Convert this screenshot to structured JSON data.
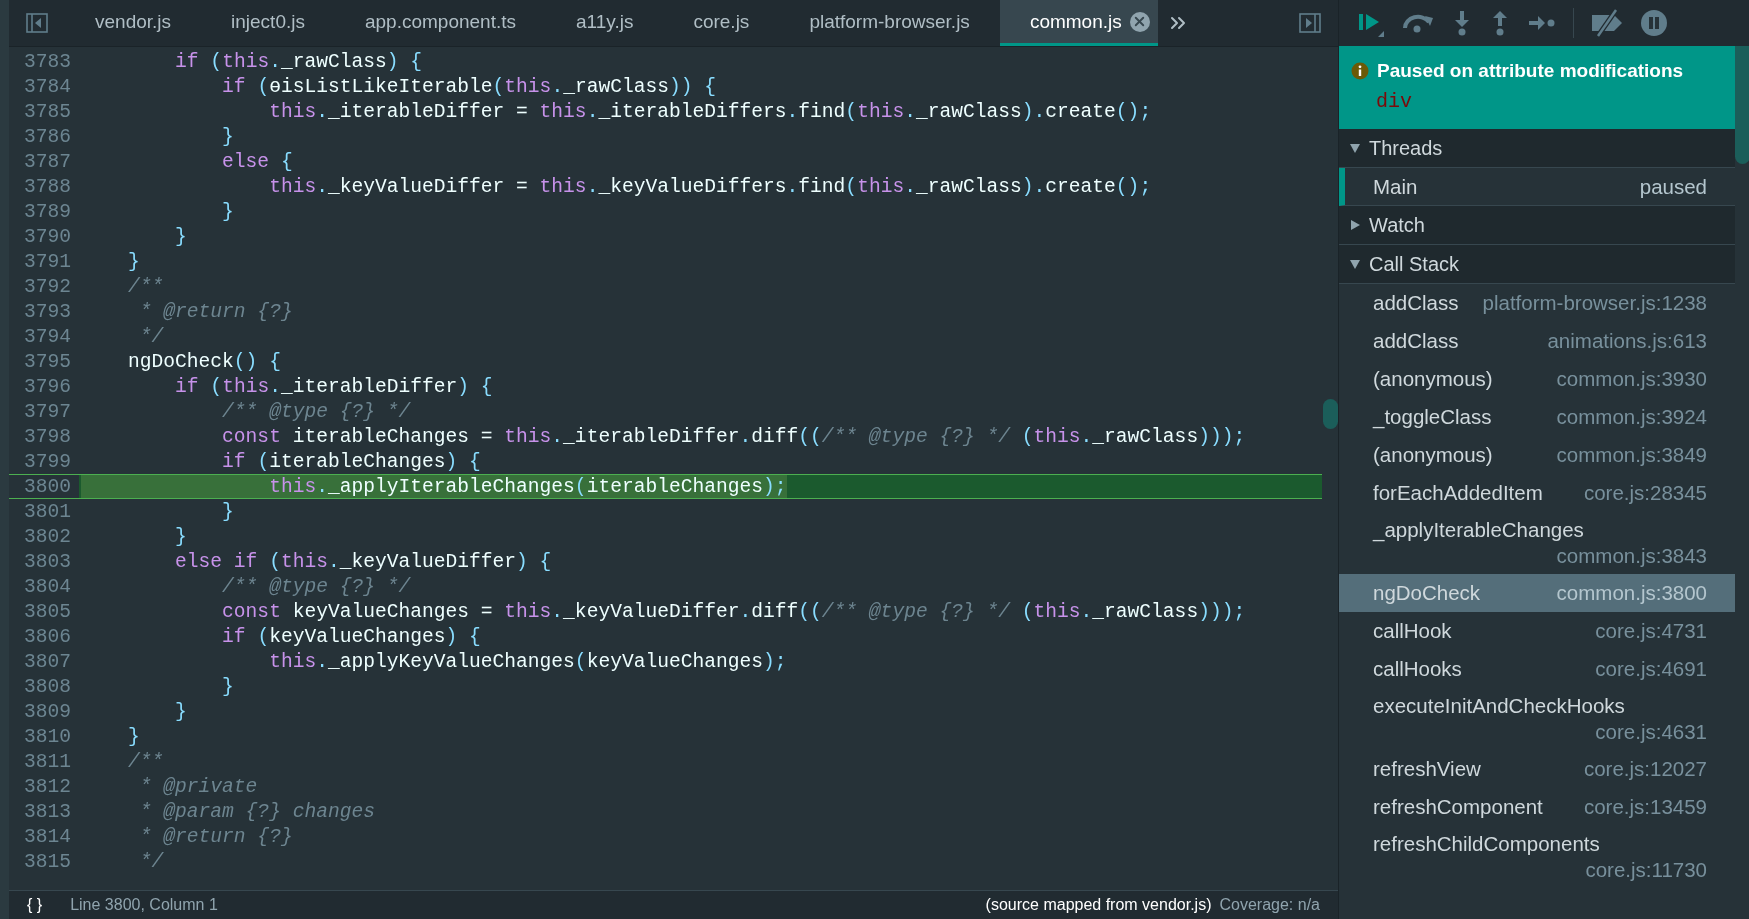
{
  "tabs": [
    {
      "label": "vendor.js",
      "selected": false
    },
    {
      "label": "inject0.js",
      "selected": false
    },
    {
      "label": "app.component.ts",
      "selected": false
    },
    {
      "label": "a11y.js",
      "selected": false
    },
    {
      "label": "core.js",
      "selected": false
    },
    {
      "label": "platform-browser.js",
      "selected": false
    },
    {
      "label": "common.js",
      "selected": true
    }
  ],
  "code_lines": [
    {
      "number": "3783",
      "current": false,
      "tokens": [
        {
          "kind": "keyword",
          "text": "        if"
        },
        {
          "kind": "punct",
          "text": " ("
        },
        {
          "kind": "keyword",
          "text": "this"
        },
        {
          "kind": "punct",
          "text": "."
        },
        {
          "kind": "ident",
          "text": "_rawClass"
        },
        {
          "kind": "punct",
          "text": ") {"
        }
      ]
    },
    {
      "number": "3784",
      "current": false,
      "tokens": [
        {
          "kind": "keyword",
          "text": "            if"
        },
        {
          "kind": "punct",
          "text": " ("
        },
        {
          "kind": "ident",
          "text": "ɵisListLikeIterable"
        },
        {
          "kind": "punct",
          "text": "("
        },
        {
          "kind": "keyword",
          "text": "this"
        },
        {
          "kind": "punct",
          "text": "."
        },
        {
          "kind": "ident",
          "text": "_rawClass"
        },
        {
          "kind": "punct",
          "text": ")) {"
        }
      ]
    },
    {
      "number": "3785",
      "current": false,
      "tokens": [
        {
          "kind": "keyword",
          "text": "                this"
        },
        {
          "kind": "punct",
          "text": "."
        },
        {
          "kind": "ident",
          "text": "_iterableDiffer = "
        },
        {
          "kind": "keyword",
          "text": "this"
        },
        {
          "kind": "punct",
          "text": "."
        },
        {
          "kind": "ident",
          "text": "_iterableDiffers"
        },
        {
          "kind": "punct",
          "text": "."
        },
        {
          "kind": "ident",
          "text": "find"
        },
        {
          "kind": "punct",
          "text": "("
        },
        {
          "kind": "keyword",
          "text": "this"
        },
        {
          "kind": "punct",
          "text": "."
        },
        {
          "kind": "ident",
          "text": "_rawClass"
        },
        {
          "kind": "punct",
          "text": ")."
        },
        {
          "kind": "ident",
          "text": "create"
        },
        {
          "kind": "punct",
          "text": "();"
        }
      ]
    },
    {
      "number": "3786",
      "current": false,
      "tokens": [
        {
          "kind": "punct",
          "text": "            }"
        }
      ]
    },
    {
      "number": "3787",
      "current": false,
      "tokens": [
        {
          "kind": "keyword",
          "text": "            else"
        },
        {
          "kind": "punct",
          "text": " {"
        }
      ]
    },
    {
      "number": "3788",
      "current": false,
      "tokens": [
        {
          "kind": "keyword",
          "text": "                this"
        },
        {
          "kind": "punct",
          "text": "."
        },
        {
          "kind": "ident",
          "text": "_keyValueDiffer = "
        },
        {
          "kind": "keyword",
          "text": "this"
        },
        {
          "kind": "punct",
          "text": "."
        },
        {
          "kind": "ident",
          "text": "_keyValueDiffers"
        },
        {
          "kind": "punct",
          "text": "."
        },
        {
          "kind": "ident",
          "text": "find"
        },
        {
          "kind": "punct",
          "text": "("
        },
        {
          "kind": "keyword",
          "text": "this"
        },
        {
          "kind": "punct",
          "text": "."
        },
        {
          "kind": "ident",
          "text": "_rawClass"
        },
        {
          "kind": "punct",
          "text": ")."
        },
        {
          "kind": "ident",
          "text": "create"
        },
        {
          "kind": "punct",
          "text": "();"
        }
      ]
    },
    {
      "number": "3789",
      "current": false,
      "tokens": [
        {
          "kind": "punct",
          "text": "            }"
        }
      ]
    },
    {
      "number": "3790",
      "current": false,
      "tokens": [
        {
          "kind": "punct",
          "text": "        }"
        }
      ]
    },
    {
      "number": "3791",
      "current": false,
      "tokens": [
        {
          "kind": "punct",
          "text": "    }"
        }
      ]
    },
    {
      "number": "3792",
      "current": false,
      "tokens": [
        {
          "kind": "comment",
          "text": "    /**"
        }
      ]
    },
    {
      "number": "3793",
      "current": false,
      "tokens": [
        {
          "kind": "comment",
          "text": "     * @return {?}"
        }
      ]
    },
    {
      "number": "3794",
      "current": false,
      "tokens": [
        {
          "kind": "comment",
          "text": "     */"
        }
      ]
    },
    {
      "number": "3795",
      "current": false,
      "tokens": [
        {
          "kind": "ident",
          "text": "    ngDoCheck"
        },
        {
          "kind": "punct",
          "text": "() {"
        }
      ]
    },
    {
      "number": "3796",
      "current": false,
      "tokens": [
        {
          "kind": "keyword",
          "text": "        if"
        },
        {
          "kind": "punct",
          "text": " ("
        },
        {
          "kind": "keyword",
          "text": "this"
        },
        {
          "kind": "punct",
          "text": "."
        },
        {
          "kind": "ident",
          "text": "_iterableDiffer"
        },
        {
          "kind": "punct",
          "text": ") {"
        }
      ]
    },
    {
      "number": "3797",
      "current": false,
      "tokens": [
        {
          "kind": "comment",
          "text": "            /** @type {?} */"
        }
      ]
    },
    {
      "number": "3798",
      "current": false,
      "tokens": [
        {
          "kind": "keyword",
          "text": "            const"
        },
        {
          "kind": "ident",
          "text": " iterableChanges = "
        },
        {
          "kind": "keyword",
          "text": "this"
        },
        {
          "kind": "punct",
          "text": "."
        },
        {
          "kind": "ident",
          "text": "_iterableDiffer"
        },
        {
          "kind": "punct",
          "text": "."
        },
        {
          "kind": "ident",
          "text": "diff"
        },
        {
          "kind": "punct",
          "text": "(("
        },
        {
          "kind": "comment",
          "text": "/** @type {?} */"
        },
        {
          "kind": "punct",
          "text": " ("
        },
        {
          "kind": "keyword",
          "text": "this"
        },
        {
          "kind": "punct",
          "text": "."
        },
        {
          "kind": "ident",
          "text": "_rawClass"
        },
        {
          "kind": "punct",
          "text": ")));"
        }
      ]
    },
    {
      "number": "3799",
      "current": false,
      "tokens": [
        {
          "kind": "keyword",
          "text": "            if"
        },
        {
          "kind": "punct",
          "text": " ("
        },
        {
          "kind": "ident",
          "text": "iterableChanges"
        },
        {
          "kind": "punct",
          "text": ") {"
        }
      ]
    },
    {
      "number": "3800",
      "current": true,
      "tokens": [
        {
          "kind": "keyword",
          "text": "                this"
        },
        {
          "kind": "punct",
          "text": "."
        },
        {
          "kind": "ident",
          "text": "_applyIterableChanges"
        },
        {
          "kind": "punct",
          "text": "("
        },
        {
          "kind": "ident",
          "text": "iterableChanges"
        },
        {
          "kind": "punct",
          "text": ");"
        }
      ]
    },
    {
      "number": "3801",
      "current": false,
      "tokens": [
        {
          "kind": "punct",
          "text": "            }"
        }
      ]
    },
    {
      "number": "3802",
      "current": false,
      "tokens": [
        {
          "kind": "punct",
          "text": "        }"
        }
      ]
    },
    {
      "number": "3803",
      "current": false,
      "tokens": [
        {
          "kind": "keyword",
          "text": "        else if"
        },
        {
          "kind": "punct",
          "text": " ("
        },
        {
          "kind": "keyword",
          "text": "this"
        },
        {
          "kind": "punct",
          "text": "."
        },
        {
          "kind": "ident",
          "text": "_keyValueDiffer"
        },
        {
          "kind": "punct",
          "text": ") {"
        }
      ]
    },
    {
      "number": "3804",
      "current": false,
      "tokens": [
        {
          "kind": "comment",
          "text": "            /** @type {?} */"
        }
      ]
    },
    {
      "number": "3805",
      "current": false,
      "tokens": [
        {
          "kind": "keyword",
          "text": "            const"
        },
        {
          "kind": "ident",
          "text": " keyValueChanges = "
        },
        {
          "kind": "keyword",
          "text": "this"
        },
        {
          "kind": "punct",
          "text": "."
        },
        {
          "kind": "ident",
          "text": "_keyValueDiffer"
        },
        {
          "kind": "punct",
          "text": "."
        },
        {
          "kind": "ident",
          "text": "diff"
        },
        {
          "kind": "punct",
          "text": "(("
        },
        {
          "kind": "comment",
          "text": "/** @type {?} */"
        },
        {
          "kind": "punct",
          "text": " ("
        },
        {
          "kind": "keyword",
          "text": "this"
        },
        {
          "kind": "punct",
          "text": "."
        },
        {
          "kind": "ident",
          "text": "_rawClass"
        },
        {
          "kind": "punct",
          "text": ")));"
        }
      ]
    },
    {
      "number": "3806",
      "current": false,
      "tokens": [
        {
          "kind": "keyword",
          "text": "            if"
        },
        {
          "kind": "punct",
          "text": " ("
        },
        {
          "kind": "ident",
          "text": "keyValueChanges"
        },
        {
          "kind": "punct",
          "text": ") {"
        }
      ]
    },
    {
      "number": "3807",
      "current": false,
      "tokens": [
        {
          "kind": "keyword",
          "text": "                this"
        },
        {
          "kind": "punct",
          "text": "."
        },
        {
          "kind": "ident",
          "text": "_applyKeyValueChanges"
        },
        {
          "kind": "punct",
          "text": "("
        },
        {
          "kind": "ident",
          "text": "keyValueChanges"
        },
        {
          "kind": "punct",
          "text": ");"
        }
      ]
    },
    {
      "number": "3808",
      "current": false,
      "tokens": [
        {
          "kind": "punct",
          "text": "            }"
        }
      ]
    },
    {
      "number": "3809",
      "current": false,
      "tokens": [
        {
          "kind": "punct",
          "text": "        }"
        }
      ]
    },
    {
      "number": "3810",
      "current": false,
      "tokens": [
        {
          "kind": "punct",
          "text": "    }"
        }
      ]
    },
    {
      "number": "3811",
      "current": false,
      "tokens": [
        {
          "kind": "comment",
          "text": "    /**"
        }
      ]
    },
    {
      "number": "3812",
      "current": false,
      "tokens": [
        {
          "kind": "comment",
          "text": "     * @private"
        }
      ]
    },
    {
      "number": "3813",
      "current": false,
      "tokens": [
        {
          "kind": "comment",
          "text": "     * @param {?} changes"
        }
      ]
    },
    {
      "number": "3814",
      "current": false,
      "tokens": [
        {
          "kind": "comment",
          "text": "     * @return {?}"
        }
      ]
    },
    {
      "number": "3815",
      "current": false,
      "tokens": [
        {
          "kind": "comment",
          "text": "     */"
        }
      ]
    }
  ],
  "status_bar": {
    "pretty_print": "{ }",
    "position": "Line 3800, Column 1",
    "source_map": "(source mapped from vendor.js)",
    "coverage": "Coverage: n/a"
  },
  "debugger": {
    "pause_message": "Paused on attribute modifications",
    "pause_target": "div",
    "sections": [
      {
        "kind": "threads",
        "title": "Threads",
        "expanded": true,
        "threads": [
          {
            "name": "Main",
            "status": "paused",
            "selected": true
          }
        ]
      },
      {
        "kind": "watch",
        "title": "Watch",
        "expanded": false
      },
      {
        "kind": "callstack",
        "title": "Call Stack",
        "expanded": true,
        "frames": [
          {
            "function": "addClass",
            "location": "platform-browser.js:1238",
            "selected": false
          },
          {
            "function": "addClass",
            "location": "animations.js:613",
            "selected": false
          },
          {
            "function": "(anonymous)",
            "location": "common.js:3930",
            "selected": false
          },
          {
            "function": "_toggleClass",
            "location": "common.js:3924",
            "selected": false
          },
          {
            "function": "(anonymous)",
            "location": "common.js:3849",
            "selected": false
          },
          {
            "function": "forEachAddedItem",
            "location": "core.js:28345",
            "selected": false
          },
          {
            "function": "_applyIterableChanges",
            "location": "common.js:3843",
            "selected": false
          },
          {
            "function": "ngDoCheck",
            "location": "common.js:3800",
            "selected": true
          },
          {
            "function": "callHook",
            "location": "core.js:4731",
            "selected": false
          },
          {
            "function": "callHooks",
            "location": "core.js:4691",
            "selected": false
          },
          {
            "function": "executeInitAndCheckHooks",
            "location": "core.js:4631",
            "selected": false
          },
          {
            "function": "refreshView",
            "location": "core.js:12027",
            "selected": false
          },
          {
            "function": "refreshComponent",
            "location": "core.js:13459",
            "selected": false
          },
          {
            "function": "refreshChildComponents",
            "location": "core.js:11730",
            "selected": false
          }
        ]
      }
    ]
  }
}
